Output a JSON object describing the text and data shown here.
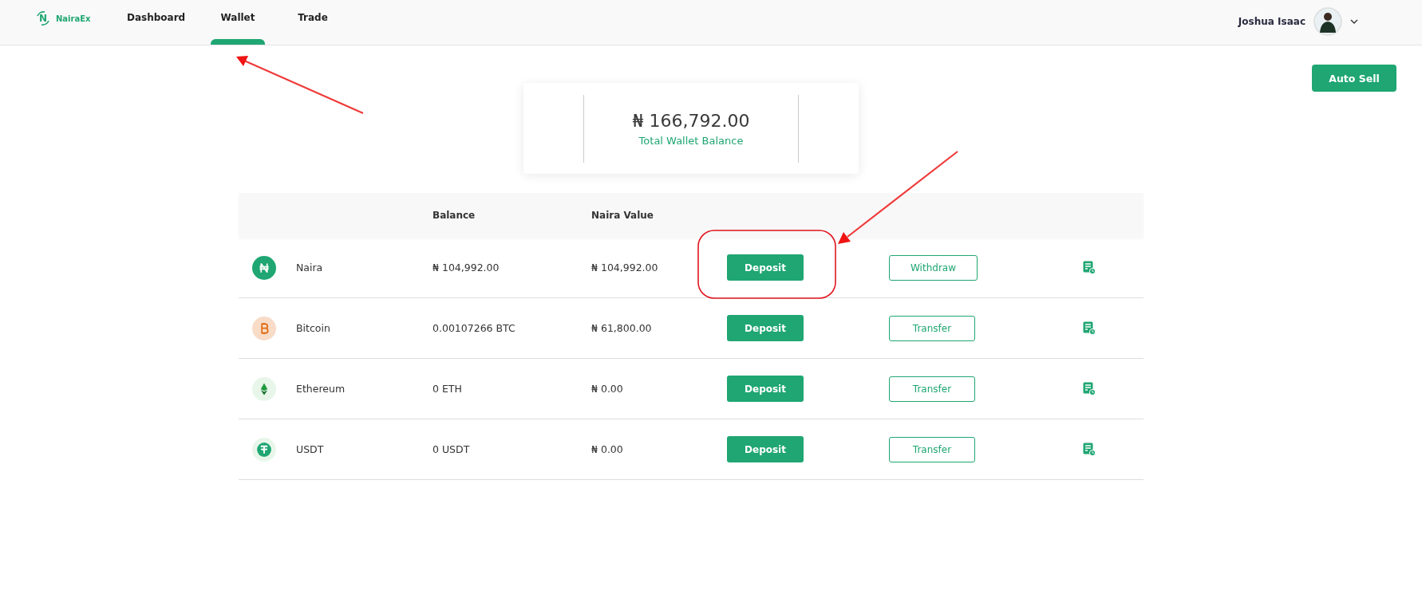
{
  "nav": {
    "logo_mark": "N",
    "logo_text": "NairaEx",
    "tabs": [
      {
        "label": "Dashboard",
        "selected": false
      },
      {
        "label": "Wallet",
        "selected": true
      },
      {
        "label": "Trade",
        "selected": false
      }
    ],
    "user": {
      "name": "Joshua Isaac"
    }
  },
  "auto_sell_button": "Auto Sell",
  "balance_card": {
    "amount": "₦ 166,792.00",
    "label": "Total Wallet Balance"
  },
  "table": {
    "columns": [
      "Balance",
      "Naira Value"
    ],
    "rows": [
      {
        "kind": "naira",
        "asset": "Naira",
        "balance": "₦ 104,992.00",
        "naira_value": "₦ 104,992.00",
        "deposit": "Deposit",
        "action": "Withdraw"
      },
      {
        "kind": "bitcoin",
        "asset": "Bitcoin",
        "balance": "0.00107266 BTC",
        "naira_value": "₦ 61,800.00",
        "deposit": "Deposit",
        "action": "Transfer"
      },
      {
        "kind": "ethereum",
        "asset": "Ethereum",
        "balance": "0 ETH",
        "naira_value": "₦ 0.00",
        "deposit": "Deposit",
        "action": "Transfer"
      },
      {
        "kind": "usdt",
        "asset": "USDT",
        "balance": "0 USDT",
        "naira_value": "₦ 0.00",
        "deposit": "Deposit",
        "action": "Transfer"
      }
    ]
  },
  "annotations": [
    {
      "kind": "arrow"
    },
    {
      "kind": "arrow"
    },
    {
      "kind": "ring"
    }
  ]
}
